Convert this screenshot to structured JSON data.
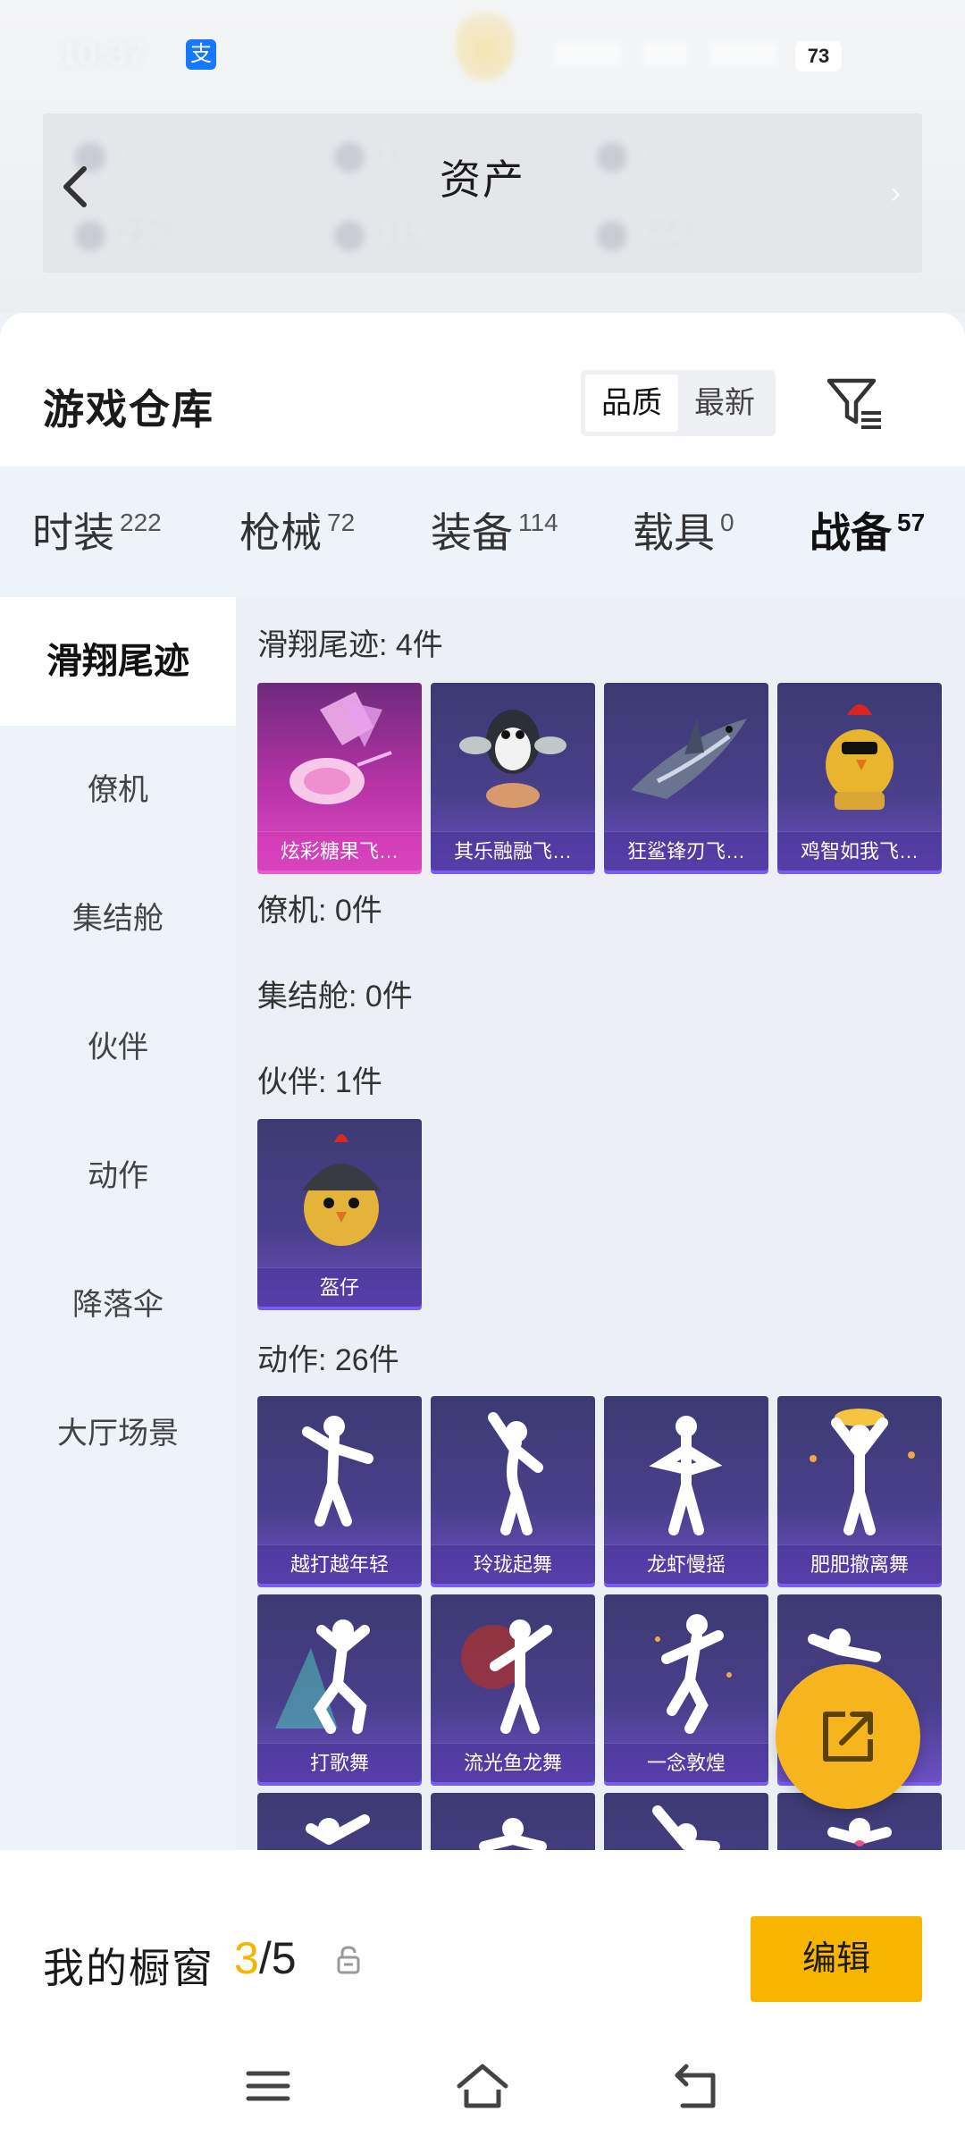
{
  "status_bar": {
    "time": "10:37",
    "battery": "73",
    "alipay_glyph": "支"
  },
  "assets_header": {
    "title": "资产",
    "values": [
      "0",
      "1",
      "0",
      "236",
      "119",
      "666"
    ]
  },
  "warehouse": {
    "title": "游戏仓库",
    "sort_options": [
      "品质",
      "最新"
    ],
    "active_sort": "品质"
  },
  "tabs": [
    {
      "label": "时装",
      "count": "222"
    },
    {
      "label": "枪械",
      "count": "72"
    },
    {
      "label": "装备",
      "count": "114"
    },
    {
      "label": "载具",
      "count": "0"
    },
    {
      "label": "战备",
      "count": "57"
    }
  ],
  "active_tab": "战备",
  "sidebar": [
    "滑翔尾迹",
    "僚机",
    "集结舱",
    "伙伴",
    "动作",
    "降落伞",
    "大厅场景"
  ],
  "active_sidebar": "滑翔尾迹",
  "sections": {
    "glide": {
      "header": "滑翔尾迹: 4件",
      "items": [
        "炫彩糖果飞…",
        "其乐融融飞…",
        "狂鲨锋刃飞…",
        "鸡智如我飞…"
      ]
    },
    "wingman": {
      "header": "僚机: 0件"
    },
    "capsule": {
      "header": "集结舱: 0件"
    },
    "partner": {
      "header": "伙伴: 1件",
      "items": [
        "盔仔"
      ]
    },
    "emote": {
      "header": "动作: 26件",
      "items": [
        "越打越年轻",
        "玲珑起舞",
        "龙虾慢摇",
        "肥肥撤离舞",
        "打歌舞",
        "流光鱼龙舞",
        "一念敦煌"
      ]
    }
  },
  "showcase": {
    "label": "我的橱窗",
    "current": "3",
    "separator": "/",
    "total": "5",
    "edit_label": "编辑"
  },
  "colors": {
    "accent": "#f7b500",
    "card_purple": "#4a3f8c",
    "card_pink": "#b733a6"
  },
  "icons": [
    "back-arrow-icon",
    "filter-icon",
    "share-icon",
    "lock-icon",
    "menu-icon",
    "home-icon",
    "back-icon"
  ]
}
